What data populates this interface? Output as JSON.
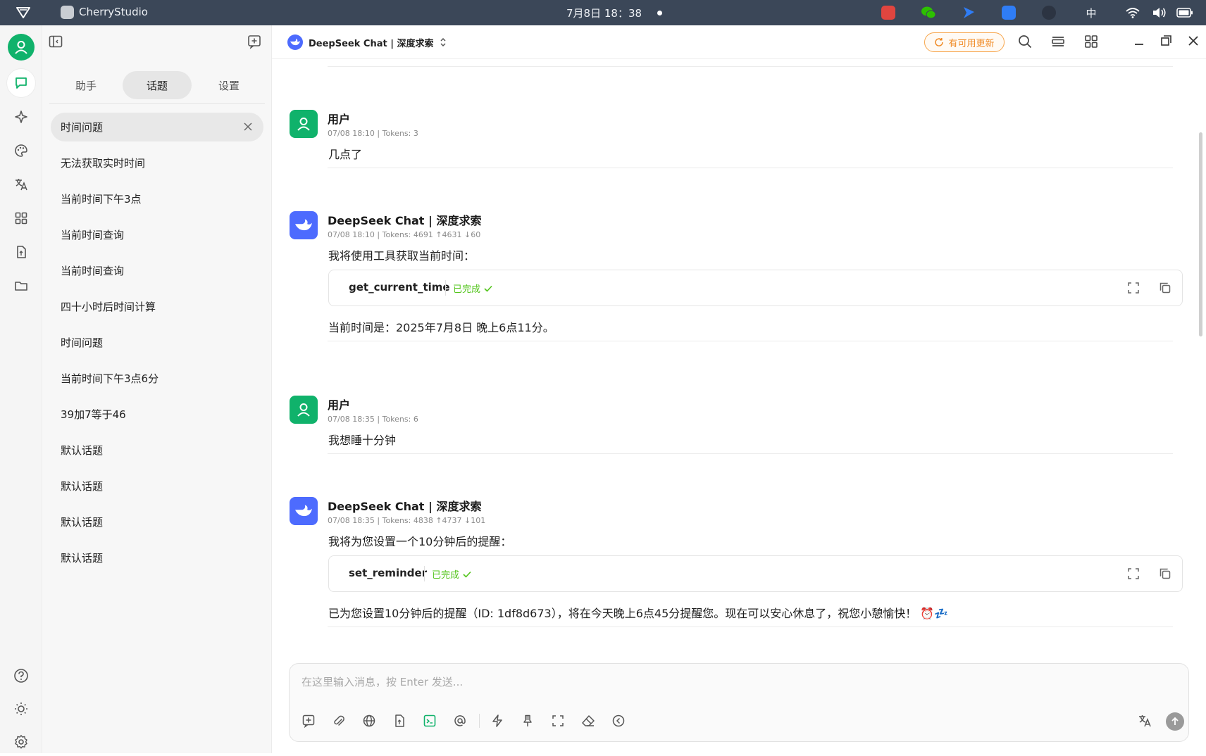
{
  "os_bar": {
    "app_name": "CherryStudio",
    "clock": "7月8日  18：38",
    "input_method": "中",
    "icons": [
      "menu-triangle-icon",
      "app-icon",
      "tray-red-app-icon",
      "wechat-icon",
      "tray-blue-flag-icon",
      "tray-blue-app-icon",
      "tray-dark-icon",
      "wifi-icon",
      "volume-icon",
      "battery-icon"
    ]
  },
  "rail": {
    "items": [
      "chat-icon",
      "sparkle-icon",
      "palette-icon",
      "translate-icon",
      "apps-grid-icon",
      "file-icon",
      "folder-icon"
    ],
    "bottom": [
      "help-icon",
      "theme-sun-icon",
      "settings-gear-icon"
    ]
  },
  "panel": {
    "tabs": [
      "助手",
      "话题",
      "设置"
    ],
    "active_tab": 1,
    "topics": [
      "时间问题",
      "无法获取实时时间",
      "当前时间下午3点",
      "当前时间查询",
      "当前时间查询",
      "四十小时后时间计算",
      "时间问题",
      "当前时间下午3点6分",
      "39加7等于46",
      "默认话题",
      "默认话题",
      "默认话题",
      "默认话题"
    ]
  },
  "header": {
    "model_name": "DeepSeek Chat | 深度求索",
    "update_label": "有可用更新"
  },
  "messages": [
    {
      "role": "user",
      "name": "用户",
      "meta": "07/08 18:10  |  Tokens: 3",
      "text": "几点了"
    },
    {
      "role": "assistant",
      "name": "DeepSeek Chat | 深度求索",
      "meta": "07/08 18:10  |  Tokens: 4691  ↑4631  ↓60",
      "text": "我将使用工具获取当前时间：",
      "tool": {
        "name": "get_current_time",
        "status": "已完成"
      },
      "result": "当前时间是：2025年7月8日 晚上6点11分。"
    },
    {
      "role": "user",
      "name": "用户",
      "meta": "07/08 18:35  |  Tokens: 6",
      "text": "我想睡十分钟"
    },
    {
      "role": "assistant",
      "name": "DeepSeek Chat | 深度求索",
      "meta": "07/08 18:35  |  Tokens: 4838  ↑4737  ↓101",
      "text": "我将为您设置一个10分钟后的提醒：",
      "tool": {
        "name": "set_reminder",
        "status": "已完成"
      },
      "result": "已为您设置10分钟后的提醒（ID: 1df8d673），将在今天晚上6点45分提醒您。现在可以安心休息了，祝您小憩愉快！ ⏰💤"
    }
  ],
  "input": {
    "placeholder": "在这里输入消息，按 Enter 发送...",
    "value": "",
    "toolbar_icons": [
      "new-topic-icon",
      "attachment-icon",
      "web-search-icon",
      "knowledge-icon",
      "mcp-terminal-icon",
      "mention-icon",
      "quick-phrase-icon",
      "pin-icon",
      "expand-icon",
      "clear-eraser-icon",
      "history-back-icon",
      "translate-icon",
      "send-icon"
    ]
  },
  "colors": {
    "user_avatar": "#10b26b",
    "bot_avatar": "#4d6bfe",
    "status_done": "#52c41a",
    "update_accent": "#f08a24",
    "os_bar": "#3b4758"
  }
}
